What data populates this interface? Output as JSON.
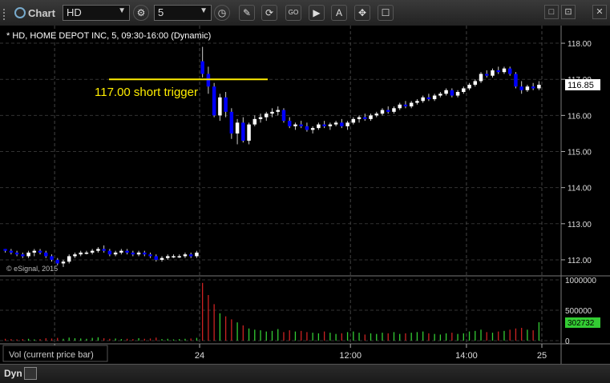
{
  "toolbar": {
    "title": "Chart",
    "symbol": "HD",
    "interval": "5",
    "tool_labels": [
      "✎",
      "⟳",
      "GO",
      "▶",
      "A",
      "✥",
      "☐"
    ],
    "window_buttons": [
      "□",
      "⊡",
      "✕"
    ]
  },
  "chart_header": "* HD, HOME DEPOT INC, 5, 09:30-16:00 (Dynamic)",
  "watermark": "© eSignal, 2015",
  "annotation": {
    "text": "117.00 short trigger",
    "price": 117.0,
    "color": "#ffee00"
  },
  "last_price_label": "116.85",
  "volume_panel_label": "Vol (current price bar)",
  "volume_last_label": "302732",
  "status": {
    "mode": "Dyn"
  },
  "colors": {
    "up": "#ffffff",
    "down": "#0000ff",
    "vol_up": "#33cc33",
    "vol_down": "#cc2222",
    "grid": "#333333"
  },
  "chart_data": {
    "type": "candlestick",
    "price_ylim": [
      111.6,
      118.4
    ],
    "price_ticks": [
      "118.00",
      "117.00",
      "116.00",
      "115.00",
      "114.00",
      "113.00",
      "112.00"
    ],
    "volume_ylim": [
      0,
      1000000
    ],
    "volume_ticks": [
      "1000000",
      "500000",
      "0"
    ],
    "x_ticks": [
      "14:00",
      "24",
      "12:00",
      "14:00",
      "25"
    ],
    "grid": true,
    "series": [
      {
        "values": [
          [
            112.3,
            112.3,
            112.2,
            112.25
          ],
          [
            112.25,
            112.3,
            112.15,
            112.2
          ],
          [
            112.2,
            112.25,
            112.1,
            112.15
          ],
          [
            112.15,
            112.2,
            112.05,
            112.1
          ],
          [
            112.1,
            112.25,
            112.05,
            112.2
          ],
          [
            112.2,
            112.3,
            112.1,
            112.25
          ],
          [
            112.25,
            112.3,
            112.15,
            112.2
          ],
          [
            112.2,
            112.25,
            112.05,
            112.1
          ],
          [
            112.1,
            112.15,
            111.95,
            112.0
          ],
          [
            112.0,
            112.05,
            111.85,
            111.9
          ],
          [
            111.9,
            112.0,
            111.8,
            111.95
          ],
          [
            111.95,
            112.15,
            111.9,
            112.1
          ],
          [
            112.1,
            112.2,
            112.05,
            112.15
          ],
          [
            112.15,
            112.25,
            112.1,
            112.2
          ],
          [
            112.2,
            112.25,
            112.15,
            112.2
          ],
          [
            112.2,
            112.3,
            112.15,
            112.25
          ],
          [
            112.25,
            112.35,
            112.2,
            112.3
          ],
          [
            112.3,
            112.4,
            112.2,
            112.25
          ],
          [
            112.25,
            112.3,
            112.1,
            112.15
          ],
          [
            112.15,
            112.25,
            112.1,
            112.2
          ],
          [
            112.2,
            112.3,
            112.15,
            112.25
          ],
          [
            112.25,
            112.3,
            112.15,
            112.2
          ],
          [
            112.2,
            112.25,
            112.1,
            112.15
          ],
          [
            112.15,
            112.25,
            112.1,
            112.2
          ],
          [
            112.2,
            112.25,
            112.1,
            112.15
          ],
          [
            112.15,
            112.2,
            112.05,
            112.1
          ],
          [
            112.1,
            112.15,
            111.95,
            112.0
          ],
          [
            112.0,
            112.1,
            111.95,
            112.05
          ],
          [
            112.05,
            112.15,
            112.0,
            112.1
          ],
          [
            112.1,
            112.15,
            112.05,
            112.1
          ],
          [
            112.1,
            112.15,
            112.05,
            112.1
          ],
          [
            112.1,
            112.2,
            112.05,
            112.15
          ],
          [
            112.15,
            112.2,
            112.05,
            112.1
          ],
          [
            112.1,
            112.25,
            112.05,
            112.2
          ],
          [
            117.5,
            117.9,
            117.05,
            117.15
          ],
          [
            117.15,
            117.35,
            116.6,
            116.8
          ],
          [
            116.8,
            116.9,
            115.95,
            116.0
          ],
          [
            116.0,
            116.6,
            115.85,
            116.5
          ],
          [
            116.5,
            116.65,
            115.95,
            116.1
          ],
          [
            116.1,
            116.2,
            115.35,
            115.5
          ],
          [
            115.5,
            115.9,
            115.2,
            115.8
          ],
          [
            115.8,
            115.95,
            115.25,
            115.3
          ],
          [
            115.3,
            115.8,
            115.2,
            115.75
          ],
          [
            115.75,
            116.0,
            115.7,
            115.9
          ],
          [
            115.9,
            116.05,
            115.8,
            115.95
          ],
          [
            115.95,
            116.1,
            115.85,
            116.05
          ],
          [
            116.05,
            116.2,
            115.95,
            116.1
          ],
          [
            116.1,
            116.25,
            116.0,
            116.15
          ],
          [
            116.15,
            116.2,
            115.8,
            115.85
          ],
          [
            115.85,
            115.95,
            115.65,
            115.7
          ],
          [
            115.7,
            115.8,
            115.6,
            115.75
          ],
          [
            115.75,
            115.85,
            115.65,
            115.7
          ],
          [
            115.7,
            115.8,
            115.55,
            115.6
          ],
          [
            115.6,
            115.7,
            115.5,
            115.65
          ],
          [
            115.65,
            115.8,
            115.6,
            115.75
          ],
          [
            115.75,
            115.85,
            115.65,
            115.7
          ],
          [
            115.7,
            115.8,
            115.6,
            115.75
          ],
          [
            115.75,
            115.85,
            115.7,
            115.8
          ],
          [
            115.8,
            115.9,
            115.65,
            115.7
          ],
          [
            115.7,
            115.85,
            115.6,
            115.8
          ],
          [
            115.8,
            115.95,
            115.75,
            115.9
          ],
          [
            115.9,
            116.0,
            115.8,
            115.95
          ],
          [
            115.95,
            116.05,
            115.85,
            115.9
          ],
          [
            115.9,
            116.05,
            115.85,
            116.0
          ],
          [
            116.0,
            116.1,
            115.95,
            116.05
          ],
          [
            116.05,
            116.2,
            116.0,
            116.15
          ],
          [
            116.15,
            116.25,
            116.05,
            116.1
          ],
          [
            116.1,
            116.25,
            116.05,
            116.2
          ],
          [
            116.2,
            116.35,
            116.15,
            116.3
          ],
          [
            116.3,
            116.4,
            116.2,
            116.25
          ],
          [
            116.25,
            116.4,
            116.2,
            116.35
          ],
          [
            116.35,
            116.45,
            116.3,
            116.4
          ],
          [
            116.4,
            116.55,
            116.35,
            116.5
          ],
          [
            116.5,
            116.6,
            116.4,
            116.45
          ],
          [
            116.45,
            116.6,
            116.4,
            116.55
          ],
          [
            116.55,
            116.65,
            116.5,
            116.6
          ],
          [
            116.6,
            116.75,
            116.55,
            116.7
          ],
          [
            116.7,
            116.75,
            116.5,
            116.55
          ],
          [
            116.55,
            116.7,
            116.5,
            116.65
          ],
          [
            116.65,
            116.8,
            116.6,
            116.75
          ],
          [
            116.75,
            116.9,
            116.7,
            116.85
          ],
          [
            116.85,
            117.0,
            116.8,
            116.95
          ],
          [
            116.95,
            117.2,
            116.9,
            117.15
          ],
          [
            117.15,
            117.25,
            117.05,
            117.1
          ],
          [
            117.1,
            117.3,
            117.05,
            117.25
          ],
          [
            117.25,
            117.35,
            117.15,
            117.2
          ],
          [
            117.2,
            117.35,
            117.15,
            117.3
          ],
          [
            117.3,
            117.35,
            117.1,
            117.15
          ],
          [
            117.15,
            117.2,
            116.75,
            116.8
          ],
          [
            116.8,
            116.95,
            116.6,
            116.7
          ],
          [
            116.7,
            116.85,
            116.65,
            116.8
          ],
          [
            116.8,
            116.9,
            116.7,
            116.75
          ],
          [
            116.75,
            116.95,
            116.7,
            116.85
          ]
        ]
      }
    ],
    "volume": [
      30000,
      25000,
      20000,
      25000,
      30000,
      20000,
      25000,
      40000,
      35000,
      45000,
      30000,
      50000,
      40000,
      35000,
      30000,
      45000,
      55000,
      40000,
      30000,
      35000,
      25000,
      30000,
      25000,
      40000,
      30000,
      35000,
      50000,
      25000,
      30000,
      20000,
      25000,
      30000,
      35000,
      45000,
      950000,
      750000,
      600000,
      450000,
      400000,
      350000,
      300000,
      250000,
      200000,
      180000,
      170000,
      150000,
      160000,
      190000,
      140000,
      170000,
      150000,
      160000,
      140000,
      130000,
      120000,
      150000,
      130000,
      110000,
      120000,
      140000,
      150000,
      130000,
      100000,
      120000,
      110000,
      130000,
      120000,
      140000,
      110000,
      120000,
      130000,
      140000,
      150000,
      120000,
      110000,
      100000,
      120000,
      130000,
      110000,
      120000,
      150000,
      160000,
      180000,
      140000,
      130000,
      150000,
      160000,
      180000,
      200000,
      210000,
      180000,
      170000,
      302732
    ]
  }
}
